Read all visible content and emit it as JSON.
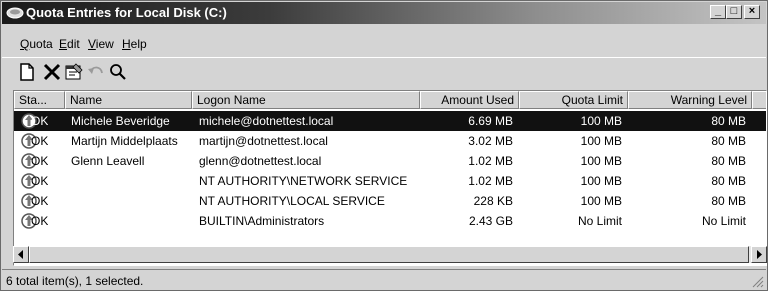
{
  "window": {
    "title": "Quota Entries for Local Disk (C:)",
    "controls": {
      "minimize": "_",
      "maximize": "□",
      "close": "×"
    }
  },
  "menu": [
    {
      "label_ul": "Q",
      "label_rest": "uota"
    },
    {
      "label_ul": "E",
      "label_rest": "dit"
    },
    {
      "label_ul": "V",
      "label_rest": "iew"
    },
    {
      "label_ul": "H",
      "label_rest": "elp"
    }
  ],
  "toolbar": {
    "icons": [
      "new-entry-icon",
      "delete-icon",
      "properties-icon",
      "undo-icon",
      "find-icon"
    ]
  },
  "columns": [
    "Sta...",
    "Name",
    "Logon Name",
    "Amount Used",
    "Quota Limit",
    "Warning Level"
  ],
  "rows": [
    {
      "status": "OK",
      "name": "Michele Beveridge",
      "logon": "michele@dotnettest.local",
      "used": "6.69 MB",
      "limit": "100 MB",
      "warning": "80 MB",
      "selected": true
    },
    {
      "status": "OK",
      "name": "Martijn Middelplaats",
      "logon": "martijn@dotnettest.local",
      "used": "3.02 MB",
      "limit": "100 MB",
      "warning": "80 MB",
      "selected": false
    },
    {
      "status": "OK",
      "name": "Glenn Leavell",
      "logon": "glenn@dotnettest.local",
      "used": "1.02 MB",
      "limit": "100 MB",
      "warning": "80 MB",
      "selected": false
    },
    {
      "status": "OK",
      "name": "",
      "logon": "NT AUTHORITY\\NETWORK SERVICE",
      "used": "1.02 MB",
      "limit": "100 MB",
      "warning": "80 MB",
      "selected": false
    },
    {
      "status": "OK",
      "name": "",
      "logon": "NT AUTHORITY\\LOCAL SERVICE",
      "used": "228 KB",
      "limit": "100 MB",
      "warning": "80 MB",
      "selected": false
    },
    {
      "status": "OK",
      "name": "",
      "logon": "BUILTIN\\Administrators",
      "used": "2.43 GB",
      "limit": "No Limit",
      "warning": "No Limit",
      "selected": false
    }
  ],
  "status_bar": {
    "text": "6 total item(s), 1 selected."
  }
}
